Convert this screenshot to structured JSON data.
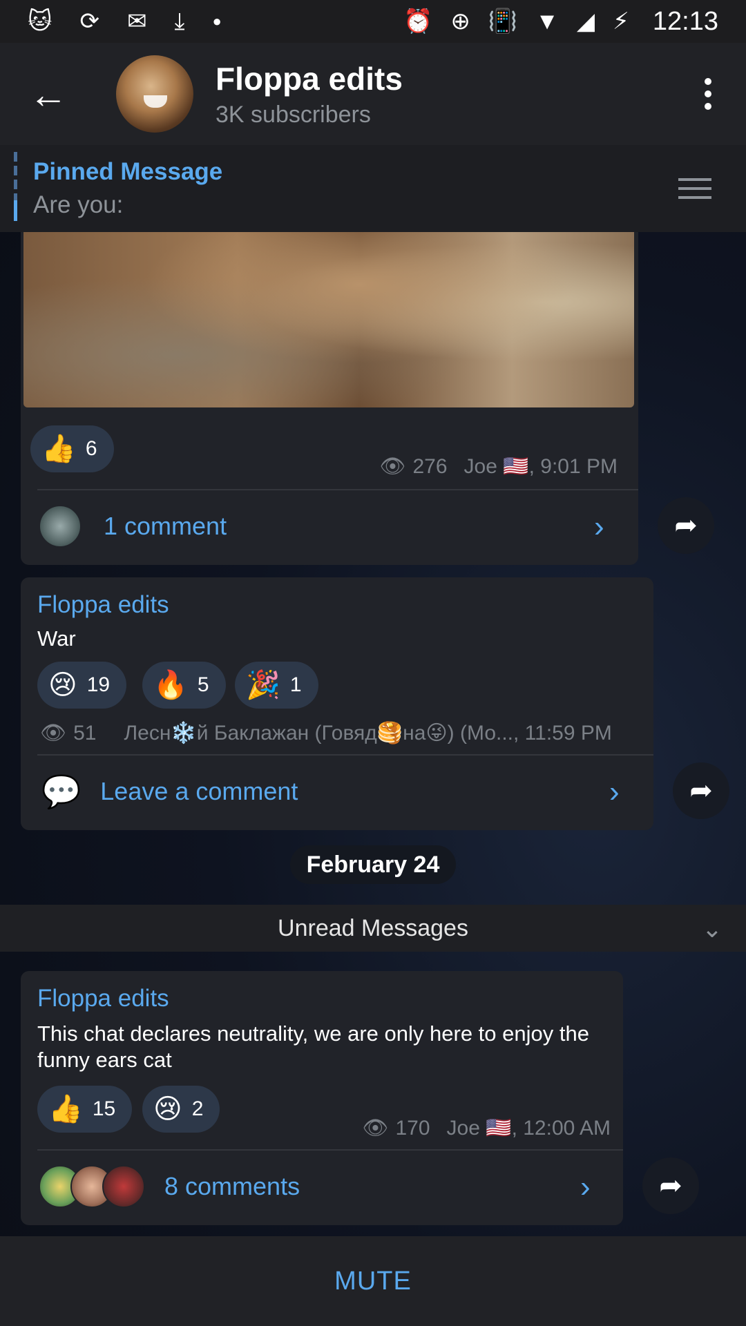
{
  "status_bar": {
    "time": "12:13",
    "left_icons": [
      "cat-app-icon",
      "sync-icon",
      "mail-icon",
      "download-icon",
      "dot-icon"
    ],
    "right_icons": [
      "alarm-icon",
      "data-saver-icon",
      "vibrate-icon",
      "wifi-icon",
      "signal-icon",
      "battery-charging-icon"
    ]
  },
  "header": {
    "title": "Floppa edits",
    "subtitle": "3K subscribers"
  },
  "pinned": {
    "title": "Pinned Message",
    "body": "Are you:"
  },
  "messages": [
    {
      "reactions": [
        {
          "emoji": "👍",
          "count": "6"
        }
      ],
      "views": "276",
      "author_time": "Joe 🇺🇸, 9:01 PM",
      "comments_label": "1 comment"
    },
    {
      "sender": "Floppa edits",
      "text": "War",
      "reactions": [
        {
          "emoji": "😢",
          "count": "19"
        },
        {
          "emoji": "🔥",
          "count": "5"
        },
        {
          "emoji": "🎉",
          "count": "1"
        }
      ],
      "views": "51",
      "author_time": "Лесн❄️й Баклажан (Говяд🥞на😜) (Мо..., 11:59 PM",
      "comments_label": "Leave a comment"
    },
    {
      "sender": "Floppa edits",
      "text": "This chat declares neutrality, we are only here to enjoy the funny ears cat",
      "reactions": [
        {
          "emoji": "👍",
          "count": "15"
        },
        {
          "emoji": "😢",
          "count": "2"
        }
      ],
      "views": "170",
      "author_time": "Joe 🇺🇸, 12:00 AM",
      "comments_label": "8 comments"
    }
  ],
  "date_separator": "February 24",
  "unread_label": "Unread Messages",
  "bottom_action": "MUTE",
  "colors": {
    "accent": "#5aa9ee",
    "header_bg": "#212226",
    "bubble_bg": "#212329",
    "reaction_bg": "#2d3849"
  }
}
